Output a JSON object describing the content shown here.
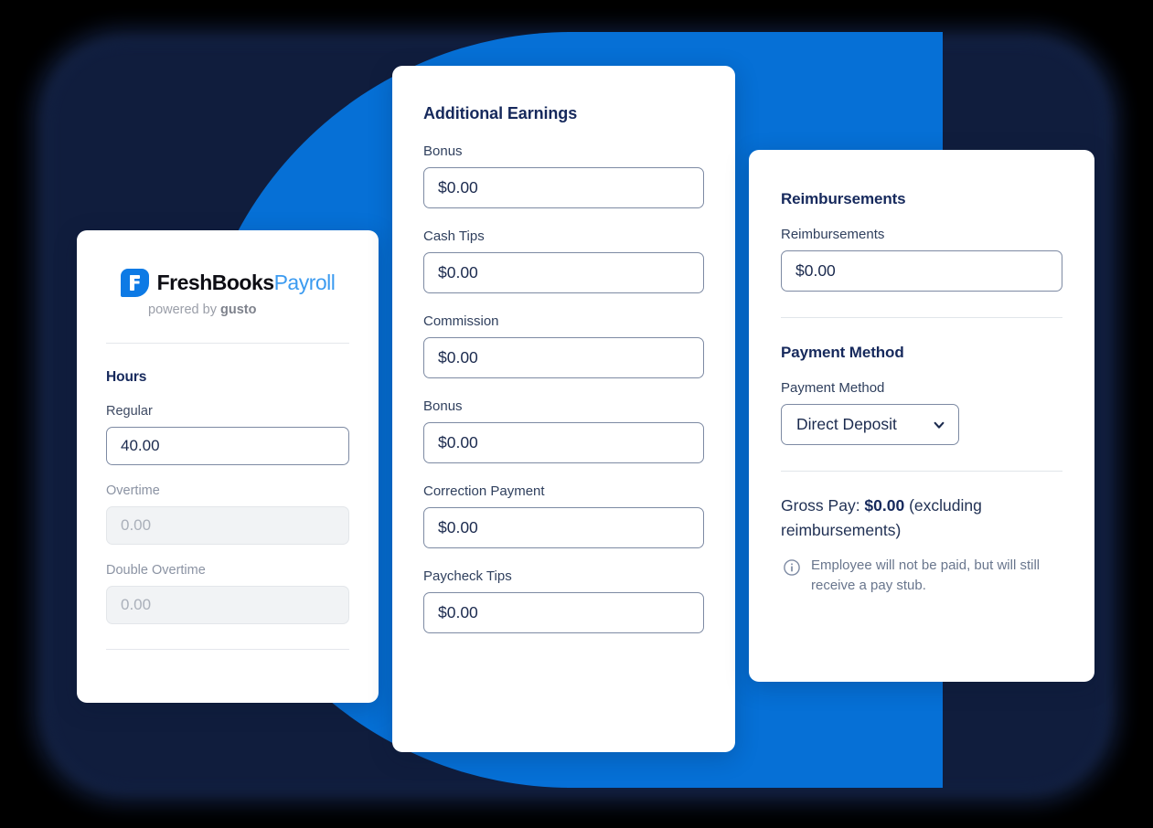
{
  "brand": {
    "logo_icon": "freshbooks-f-logo-icon",
    "name_primary": "FreshBooks",
    "name_secondary": "Payroll",
    "powered_prefix": "powered by ",
    "powered_partner": "gusto",
    "accent_blue": "#0670d6",
    "logo_blue": "#0d7ae5",
    "navy": "#16295c"
  },
  "hours_card": {
    "section_title": "Hours",
    "fields": [
      {
        "label": "Regular",
        "value": "40.00",
        "placeholder": "0.00",
        "disabled": false
      },
      {
        "label": "Overtime",
        "value": "",
        "placeholder": "0.00",
        "disabled": true
      },
      {
        "label": "Double Overtime",
        "value": "",
        "placeholder": "0.00",
        "disabled": true
      }
    ]
  },
  "earnings_card": {
    "section_title": "Additional Earnings",
    "fields": [
      {
        "label": "Bonus",
        "value": "$0.00"
      },
      {
        "label": "Cash Tips",
        "value": "$0.00"
      },
      {
        "label": "Commission",
        "value": "$0.00"
      },
      {
        "label": "Bonus",
        "value": "$0.00"
      },
      {
        "label": "Correction Payment",
        "value": "$0.00"
      },
      {
        "label": "Paycheck Tips",
        "value": "$0.00"
      }
    ]
  },
  "reimbursements_card": {
    "reimbursements_title": "Reimbursements",
    "reimbursements_label": "Reimbursements",
    "reimbursements_value": "$0.00",
    "payment_title": "Payment Method",
    "payment_label": "Payment Method",
    "payment_value": "Direct Deposit",
    "payment_chevron_icon": "chevron-down-icon",
    "gross_prefix": "Gross Pay: ",
    "gross_amount": "$0.00",
    "gross_suffix": " (excluding reimbursements)",
    "note_icon": "info-circle-icon",
    "note_text": "Employee will not be paid, but will still receive a pay stub."
  }
}
